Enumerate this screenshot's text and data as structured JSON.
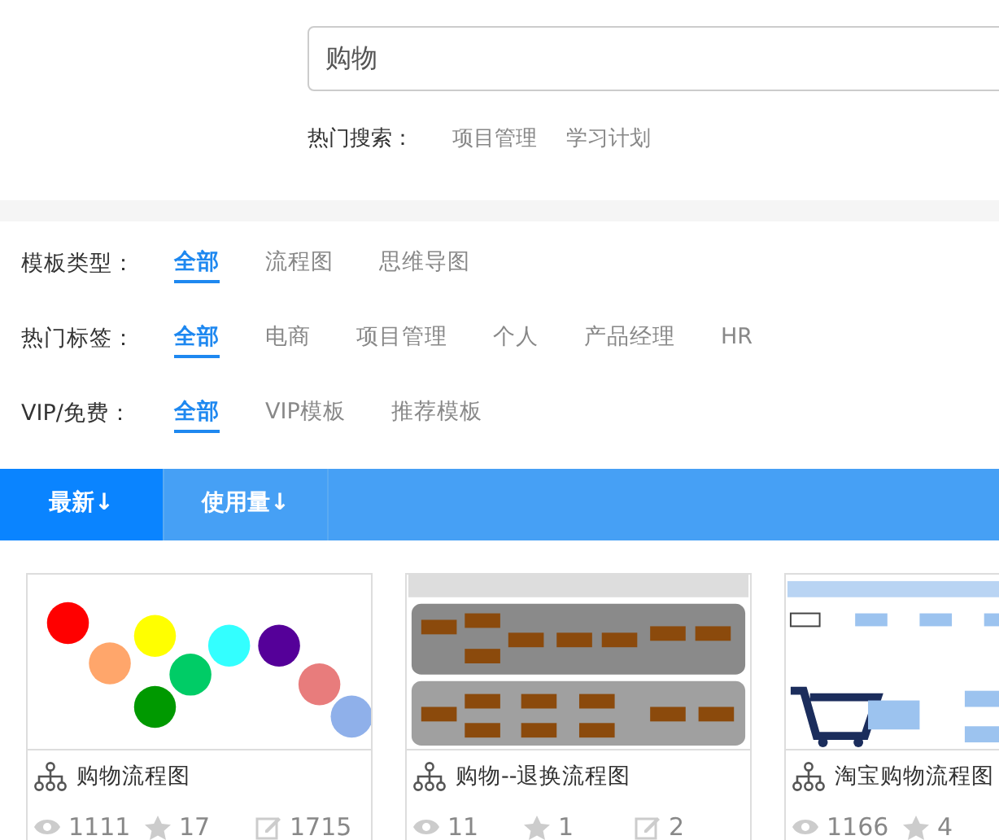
{
  "search": {
    "value": "购物"
  },
  "hot_search": {
    "label": "热门搜索：",
    "items": [
      "项目管理",
      "学习计划"
    ]
  },
  "filters": [
    {
      "label": "模板类型：",
      "options": [
        {
          "text": "全部",
          "selected": true
        },
        {
          "text": "流程图",
          "selected": false
        },
        {
          "text": "思维导图",
          "selected": false
        }
      ]
    },
    {
      "label": "热门标签：",
      "options": [
        {
          "text": "全部",
          "selected": true
        },
        {
          "text": "电商",
          "selected": false
        },
        {
          "text": "项目管理",
          "selected": false
        },
        {
          "text": "个人",
          "selected": false
        },
        {
          "text": "产品经理",
          "selected": false
        },
        {
          "text": "HR",
          "selected": false
        }
      ]
    },
    {
      "label": "VIP/免费：",
      "options": [
        {
          "text": "全部",
          "selected": true
        },
        {
          "text": "VIP模板",
          "selected": false
        },
        {
          "text": "推荐模板",
          "selected": false
        }
      ]
    }
  ],
  "sort_tabs": [
    {
      "label": "最新↓",
      "selected": true
    },
    {
      "label": "使用量↓",
      "selected": false
    }
  ],
  "templates": [
    {
      "title": "购物流程图",
      "views": "1111",
      "stars": "17",
      "edits": "1715",
      "kind": "picture"
    },
    {
      "title": "购物--退换流程图",
      "views": "11",
      "stars": "1",
      "edits": "2",
      "kind": "picture"
    },
    {
      "title": "淘宝购物流程图",
      "views": "1166",
      "stars": "4",
      "kind": "picture"
    }
  ]
}
